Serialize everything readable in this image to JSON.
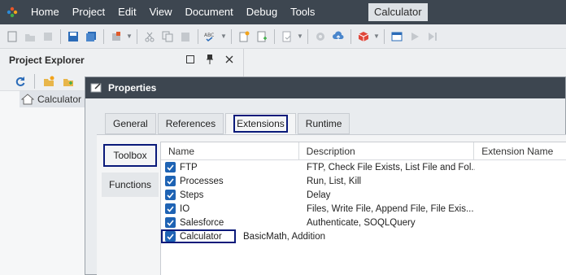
{
  "menubar": {
    "items": [
      "Home",
      "Project",
      "Edit",
      "View",
      "Document",
      "Debug",
      "Tools"
    ],
    "title": "Calculator"
  },
  "explorer": {
    "title": "Project Explorer",
    "tree_item": "Calculator"
  },
  "dialog": {
    "title": "Properties",
    "tabs": [
      "General",
      "References",
      "Extensions",
      "Runtime"
    ],
    "active_tab": "Extensions",
    "side_tabs": [
      "Toolbox",
      "Functions"
    ],
    "active_side_tab": "Toolbox",
    "columns": [
      "Name",
      "Description",
      "Extension Name"
    ],
    "rows": [
      {
        "name": "FTP",
        "description": "FTP, Check File Exists, List File and Fol...",
        "checked": true
      },
      {
        "name": "Processes",
        "description": "Run, List, Kill",
        "checked": true
      },
      {
        "name": "Steps",
        "description": "Delay",
        "checked": true
      },
      {
        "name": "IO",
        "description": "Files, Write File, Append File, File Exis...",
        "checked": true
      },
      {
        "name": "Salesforce",
        "description": "Authenticate, SOQLQuery",
        "checked": true
      },
      {
        "name": "Calculator",
        "description": "BasicMath, Addition",
        "checked": true
      }
    ]
  },
  "colors": {
    "menubar_bg": "#3d4650",
    "accent_checkbox": "#1e63b4",
    "highlight_border": "#0a1a7a"
  }
}
